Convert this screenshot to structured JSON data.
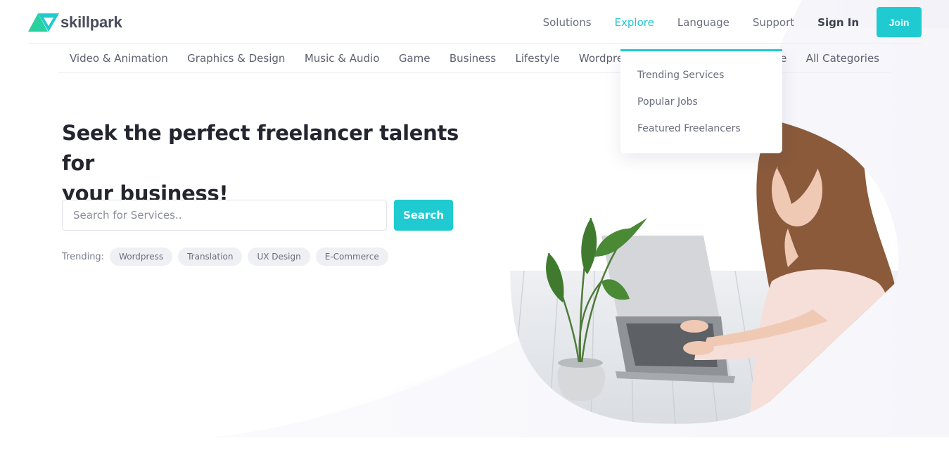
{
  "brand": {
    "name": "skillpark",
    "accent": "#1fcad1"
  },
  "nav": {
    "solutions": "Solutions",
    "explore": "Explore",
    "language": "Language",
    "support": "Support",
    "sign_in": "Sign In",
    "join": "Join"
  },
  "categories": [
    "Video & Animation",
    "Graphics & Design",
    "Music & Audio",
    "Game",
    "Business",
    "Lifestyle",
    "Wordpress",
    "e",
    "All Categories"
  ],
  "explore_menu": {
    "items": [
      "Trending Services",
      "Popular Jobs",
      "Featured Freelancers"
    ]
  },
  "hero": {
    "title_line1": "Seek the perfect freelancer talents for",
    "title_line2": "your business!",
    "search_placeholder": "Search for Services..",
    "search_button": "Search",
    "trending_label": "Trending:",
    "tags": [
      "Wordpress",
      "Translation",
      "UX Design",
      "E-Commerce"
    ]
  },
  "icons": {
    "logo": "skillpark-logo-icon"
  }
}
